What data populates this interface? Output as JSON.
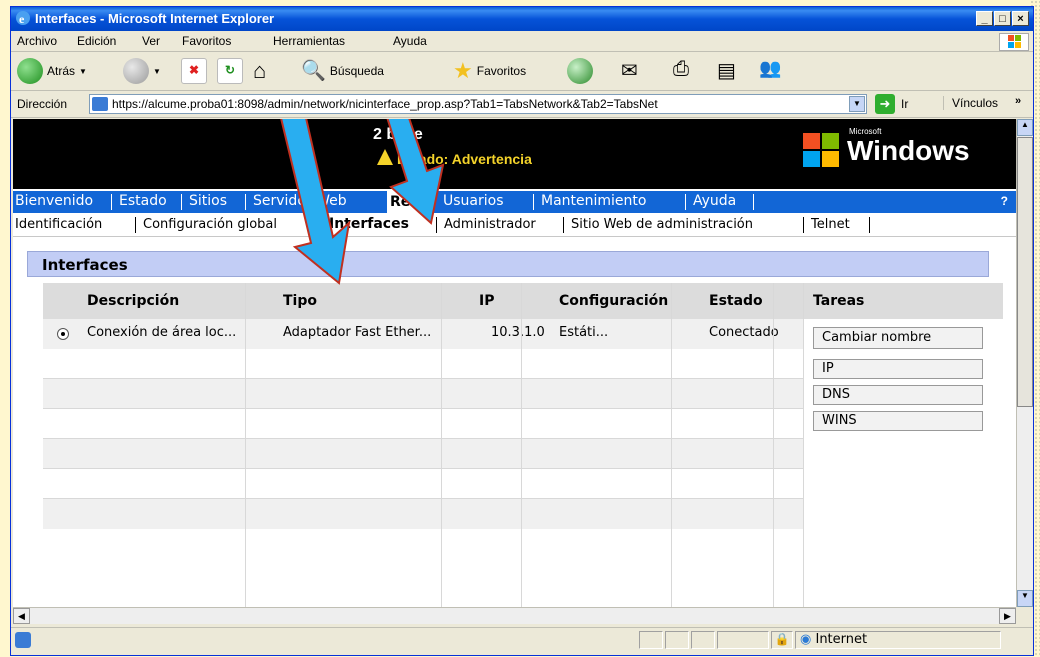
{
  "window": {
    "title": "Interfaces - Microsoft Internet Explorer",
    "buttons": [
      "_",
      "□",
      "×"
    ]
  },
  "menu": [
    "Archivo",
    "Edición",
    "Ver",
    "Favoritos",
    "Herramientas",
    "Ayuda"
  ],
  "toolbar": {
    "back": "Atrás",
    "search": "Búsqueda",
    "favorites": "Favoritos"
  },
  "address": {
    "label": "Dirección",
    "url": "https://alcume.proba01:8098/admin/network/nicinterface_prop.asp?Tab1=TabsNetwork&Tab2=TabsNet",
    "go": "Ir",
    "links": "Vínculos"
  },
  "banner": {
    "server": "2 base",
    "status": "Estado: Advertencia",
    "brand_small": "Microsoft",
    "brand": "Windows"
  },
  "nav1": [
    "Bienvenido",
    "Estado",
    "Sitios",
    "Servidor Web",
    "Red",
    "Usuarios",
    "Mantenimiento",
    "Ayuda"
  ],
  "nav1_help": "?",
  "nav2": [
    "Identificación",
    "Configuración global",
    "Interfaces",
    "Administrador",
    "Sitio Web de administración",
    "Telnet"
  ],
  "section_title": "Interfaces",
  "table": {
    "headers": [
      "Descripción",
      "Tipo",
      "IP",
      "Configuración",
      "Estado",
      "Tareas"
    ],
    "rows": [
      {
        "descripcion": "Conexión de área loc...",
        "tipo": "Adaptador Fast Ether...",
        "ip": "10.3.1.0",
        "config": "Estáti...",
        "estado": "Conectado"
      }
    ],
    "tasks": [
      "Cambiar nombre",
      "IP",
      "DNS",
      "WINS"
    ]
  },
  "status": {
    "zone": "Internet"
  },
  "colors": {
    "nav_blue": "#1266d6",
    "section_bg": "#c2cdf5",
    "arrow": "#29aef0"
  }
}
